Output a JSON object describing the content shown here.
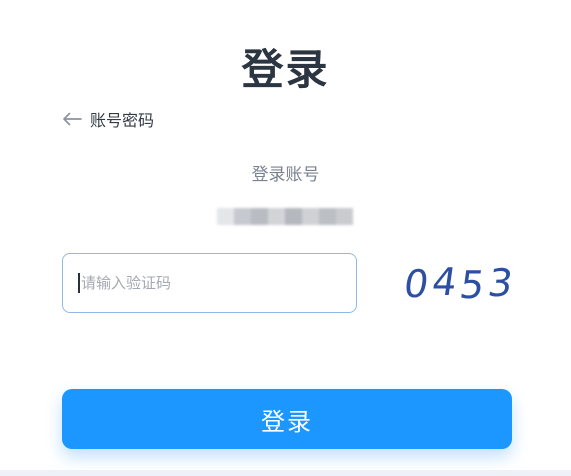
{
  "page": {
    "title": "登录"
  },
  "back_link": {
    "icon": "arrow-left-icon",
    "label": "账号密码"
  },
  "account": {
    "label": "登录账号",
    "value_blurred": true,
    "mask_colors": [
      "#e4e6ea",
      "#c6c9cf",
      "#b9bcc2",
      "#d2d4d8",
      "#b5b8be",
      "#cfd1d5",
      "#bcbfc4",
      "#c9cbcf"
    ]
  },
  "captcha_input": {
    "placeholder": "请输入验证码",
    "value": ""
  },
  "captcha": {
    "digits": [
      "0",
      "4",
      "5",
      "3"
    ],
    "color": "#2c4fa3"
  },
  "login_button": {
    "label": "登录"
  },
  "colors": {
    "accent": "#1b97ff",
    "title": "#2c3542",
    "input_border": "#8fb8e6",
    "muted_text": "#7a8290"
  }
}
